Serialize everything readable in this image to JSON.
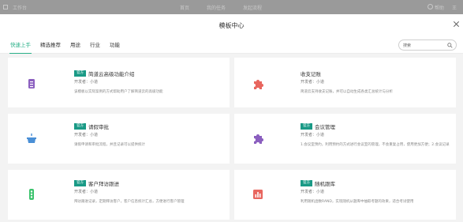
{
  "background_bar": {
    "app_label": "工作台",
    "nav": [
      "首页",
      "我的任务",
      "发起流程"
    ],
    "help": "帮助",
    "account": "王"
  },
  "modal": {
    "title": "模板中心",
    "tabs": [
      {
        "label": "快速上手",
        "active": true
      },
      {
        "label": "精选推荐",
        "active": false
      },
      {
        "label": "用途",
        "active": false
      },
      {
        "label": "行业",
        "active": false
      },
      {
        "label": "功能",
        "active": false
      }
    ],
    "search": {
      "value": "搜索",
      "placeholder": "搜索"
    }
  },
  "cards": [
    {
      "badge": "官方",
      "title": "简道云高级功能介绍",
      "developer": "开发者：小道",
      "desc": "该模板以实际案例的方式帮助用户了解简道云的高级功能",
      "icon": "phone-book-icon",
      "color": "#8b5fbf"
    },
    {
      "badge": "",
      "title": "收支记账",
      "developer": "开发者：小道",
      "desc": "简道云支持收支记账，并可以自动生成各类汇总统计与分析",
      "icon": "puzzle-icon",
      "color": "#e8665f"
    },
    {
      "badge": "官方",
      "title": "请假审批",
      "developer": "开发者：小道",
      "desc": "请假申请和审批流程，并且记录可以提供统计",
      "icon": "cake-icon",
      "color": "#4a8fd6"
    },
    {
      "badge": "官方",
      "title": "会议管理",
      "developer": "开发者：小道",
      "desc": "1.会议室预约，利用预约的方式进行会议室的管理，不会重复占用，使用更加方便；2.会议记录",
      "icon": "puzzle-icon",
      "color": "#8b5fbf"
    },
    {
      "badge": "官方",
      "title": "客户拜访跟进",
      "developer": "开发者：小道",
      "desc": "拜访跟进记录，定期拜访客户，客户信息统计汇总，方便进行客户管理",
      "icon": "traffic-light-icon",
      "color": "#3cc36d"
    },
    {
      "badge": "官方",
      "title": "随机跟库",
      "developer": "开发者：小道",
      "desc": "利用随机函数RAND，实现随机从题库中抽取考题的效果，适合考试使用",
      "icon": "bar-chart-icon",
      "color": "#e8665f"
    }
  ]
}
